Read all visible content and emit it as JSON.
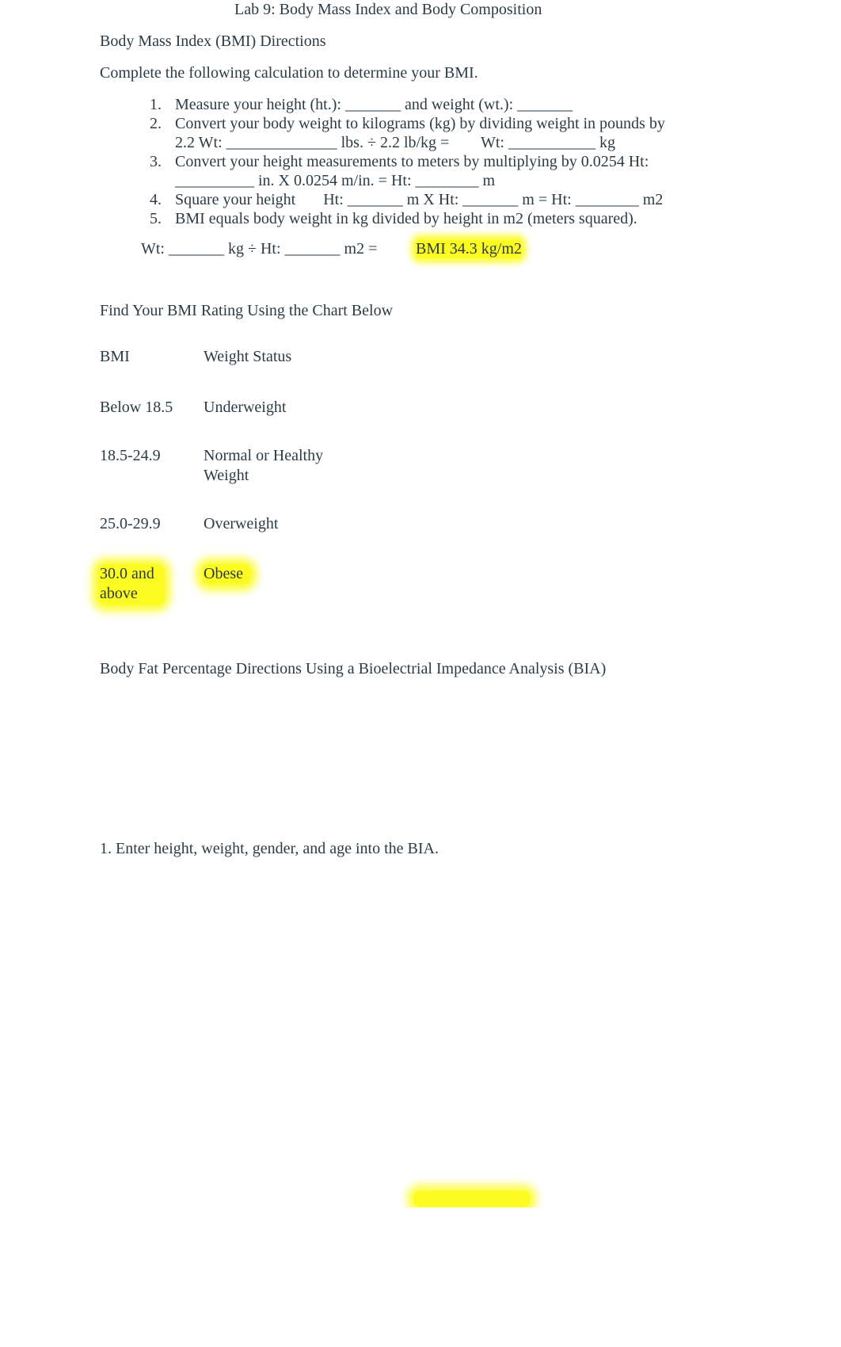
{
  "document": {
    "title": "Lab 9: Body Mass Index and Body Composition",
    "bmi_section": {
      "heading": "Body Mass Index (BMI) Directions",
      "intro": "Complete the following calculation to determine your BMI.",
      "steps": [
        {
          "num": "1.",
          "lines": [
            "Measure your height (ht.): _______ and weight (wt.): _______"
          ]
        },
        {
          "num": "2.",
          "lines": [
            "Convert your body weight to kilograms (kg) by dividing weight in pounds by",
            "2.2 Wt: ______________ lbs. ÷ 2.2 lb/kg =        Wt: ___________ kg"
          ]
        },
        {
          "num": "3.",
          "lines": [
            "Convert your height measurements to meters by multiplying by 0.0254 Ht:",
            "__________ in. X 0.0254 m/in. = Ht: ________ m"
          ]
        },
        {
          "num": "4.",
          "lines": [
            "Square your height       Ht: _______ m X Ht: _______ m = Ht: ________ m2"
          ]
        },
        {
          "num": "5.",
          "lines": [
            "BMI equals body weight in kg divided by height in m2 (meters squared)."
          ]
        }
      ],
      "formula": "Wt: _______ kg ÷ Ht: _______ m2 =",
      "result": "BMI 34.3 kg/m2"
    },
    "rating_section": {
      "heading": "Find Your BMI Rating Using the Chart Below",
      "columns": [
        "BMI",
        "Weight Status"
      ],
      "rows": [
        {
          "bmi": [
            "Below 18.5"
          ],
          "status": [
            "Underweight"
          ],
          "highlighted": false
        },
        {
          "bmi": [
            "18.5-24.9"
          ],
          "status": [
            "Normal or Healthy",
            "Weight"
          ],
          "highlighted": false
        },
        {
          "bmi": [
            "25.0-29.9"
          ],
          "status": [
            "Overweight"
          ],
          "highlighted": false
        },
        {
          "bmi": [
            "30.0 and",
            "above"
          ],
          "status": [
            "Obese"
          ],
          "highlighted": true
        }
      ]
    },
    "bia_section": {
      "heading": "Body Fat Percentage Directions Using a Bioelectrial Impedance Analysis (BIA)",
      "steps": [
        "1. Enter height, weight, gender, and age into the BIA."
      ]
    },
    "colors": {
      "text": "#2d3b45",
      "highlight": "#fcfc22",
      "background": "#ffffff"
    }
  }
}
